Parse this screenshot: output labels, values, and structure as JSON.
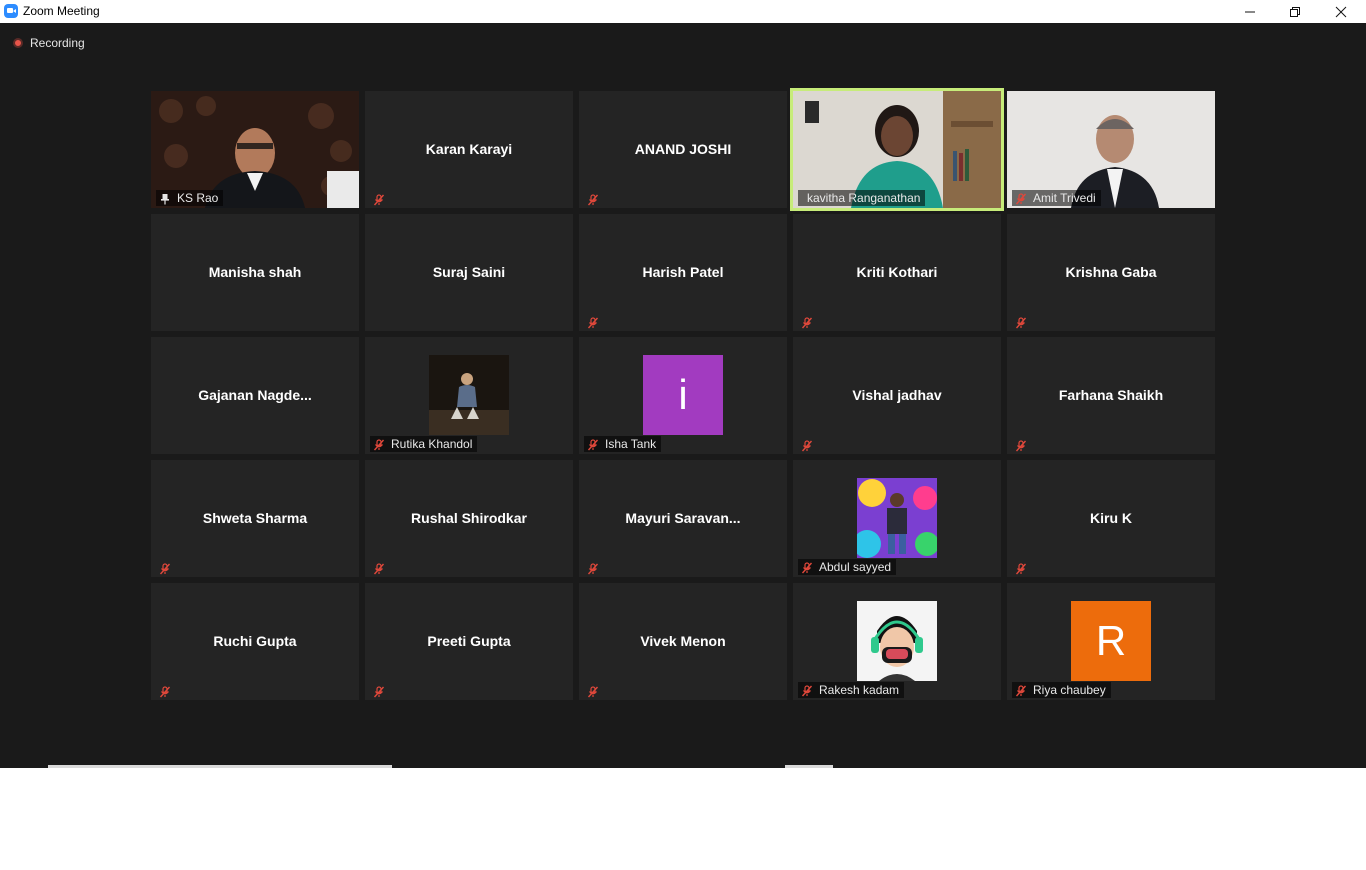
{
  "window": {
    "title": "Zoom Meeting"
  },
  "recording": {
    "label": "Recording"
  },
  "colors": {
    "active_speaker": "#c7ec7a",
    "tile_bg": "#242424",
    "mute": "#e0483b"
  },
  "participants": [
    {
      "name": "",
      "footer": "KS Rao",
      "video": true,
      "pinned": true
    },
    {
      "name": "Karan Karayi",
      "footer": "",
      "muted": true
    },
    {
      "name": "ANAND JOSHI",
      "footer": "",
      "muted": true
    },
    {
      "name": "",
      "footer": "kavitha Ranganathan",
      "video": true,
      "active": true
    },
    {
      "name": "",
      "footer": "Amit Trivedi",
      "video": true,
      "muted": true
    },
    {
      "name": "Manisha shah",
      "footer": ""
    },
    {
      "name": "Suraj Saini",
      "footer": ""
    },
    {
      "name": "Harish Patel",
      "footer": "",
      "muted": true
    },
    {
      "name": "Kriti Kothari",
      "footer": "",
      "muted": true
    },
    {
      "name": "Krishna Gaba",
      "footer": "",
      "muted": true
    },
    {
      "name": "Gajanan  Nagde...",
      "footer": ""
    },
    {
      "name": "",
      "footer": "Rutika Khandol",
      "avatar": "photo-beach",
      "muted": true
    },
    {
      "name": "",
      "footer": "Isha Tank",
      "avatar": "letter",
      "avatar_letter": "i",
      "avatar_color": "#a23bc0",
      "muted": true
    },
    {
      "name": "Vishal jadhav",
      "footer": "",
      "muted": true
    },
    {
      "name": "Farhana Shaikh",
      "footer": "",
      "muted": true
    },
    {
      "name": "Shweta Sharma",
      "footer": "",
      "muted": true
    },
    {
      "name": "Rushal Shirodkar",
      "footer": "",
      "muted": true
    },
    {
      "name": "Mayuri  Saravan...",
      "footer": "",
      "muted": true
    },
    {
      "name": "",
      "footer": "Abdul sayyed",
      "avatar": "photo-graffiti",
      "muted": true
    },
    {
      "name": "Kiru K",
      "footer": "",
      "muted": true
    },
    {
      "name": "Ruchi Gupta",
      "footer": "",
      "muted": true
    },
    {
      "name": "Preeti Gupta",
      "footer": "",
      "muted": true
    },
    {
      "name": "Vivek Menon",
      "footer": "",
      "muted": true
    },
    {
      "name": "",
      "footer": "Rakesh kadam",
      "avatar": "cartoon-headphones",
      "muted": true
    },
    {
      "name": "",
      "footer": "Riya chaubey",
      "avatar": "letter",
      "avatar_letter": "R",
      "avatar_color": "#ed6c0c",
      "muted": true
    }
  ]
}
